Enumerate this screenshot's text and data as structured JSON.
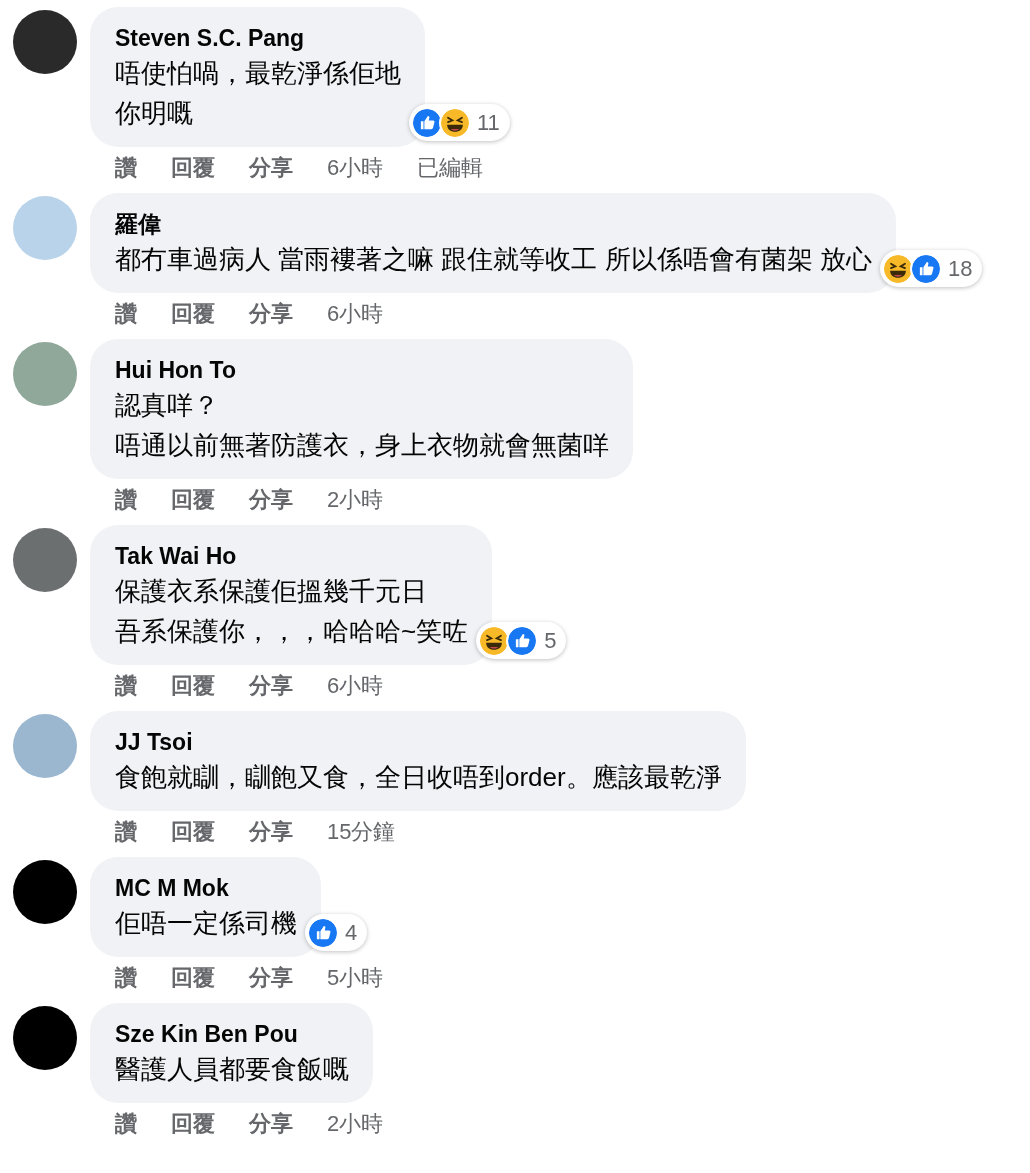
{
  "comments": [
    {
      "author": "Steven S.C. Pang",
      "lines": [
        "唔使怕喎，最乾淨係佢地",
        "你明嘅"
      ],
      "reactions": {
        "icons": [
          {
            "kind": "like"
          },
          {
            "kind": "haha"
          }
        ],
        "count": "11"
      },
      "actions": [
        "讚",
        "回覆",
        "分享"
      ],
      "time": "6小時",
      "edited": "已編輯"
    },
    {
      "author": "羅偉",
      "lines": [
        "都冇車過病人 當雨褸著之嘛 跟住就等收工 所以係唔會有菌架 放心"
      ],
      "reactions": {
        "icons": [
          {
            "kind": "haha"
          },
          {
            "kind": "like"
          }
        ],
        "count": "18"
      },
      "actions": [
        "讚",
        "回覆",
        "分享"
      ],
      "time": "6小時"
    },
    {
      "author": "Hui Hon To",
      "lines": [
        "認真咩？",
        "唔通以前無著防護衣，身上衣物就會無菌咩"
      ],
      "actions": [
        "讚",
        "回覆",
        "分享"
      ],
      "time": "2小時"
    },
    {
      "author": "Tak Wai Ho",
      "lines": [
        "保護衣系保護佢搵幾千元日",
        "吾系保護你，，，哈哈哈~笑咗"
      ],
      "reactions": {
        "icons": [
          {
            "kind": "haha"
          },
          {
            "kind": "like"
          }
        ],
        "count": "5"
      },
      "actions": [
        "讚",
        "回覆",
        "分享"
      ],
      "time": "6小時"
    },
    {
      "author": "JJ Tsoi",
      "lines": [
        "食飽就瞓，瞓飽又食，全日收唔到order。應該最乾淨"
      ],
      "actions": [
        "讚",
        "回覆",
        "分享"
      ],
      "time": "15分鐘"
    },
    {
      "author": "MC M Mok",
      "lines": [
        "佢唔一定係司機"
      ],
      "reactions": {
        "icons": [
          {
            "kind": "like"
          }
        ],
        "count": "4"
      },
      "actions": [
        "讚",
        "回覆",
        "分享"
      ],
      "time": "5小時"
    },
    {
      "author": "Sze Kin Ben Pou",
      "lines": [
        "醫護人員都要食飯嘅"
      ],
      "actions": [
        "讚",
        "回覆",
        "分享"
      ],
      "time": "2小時"
    }
  ]
}
